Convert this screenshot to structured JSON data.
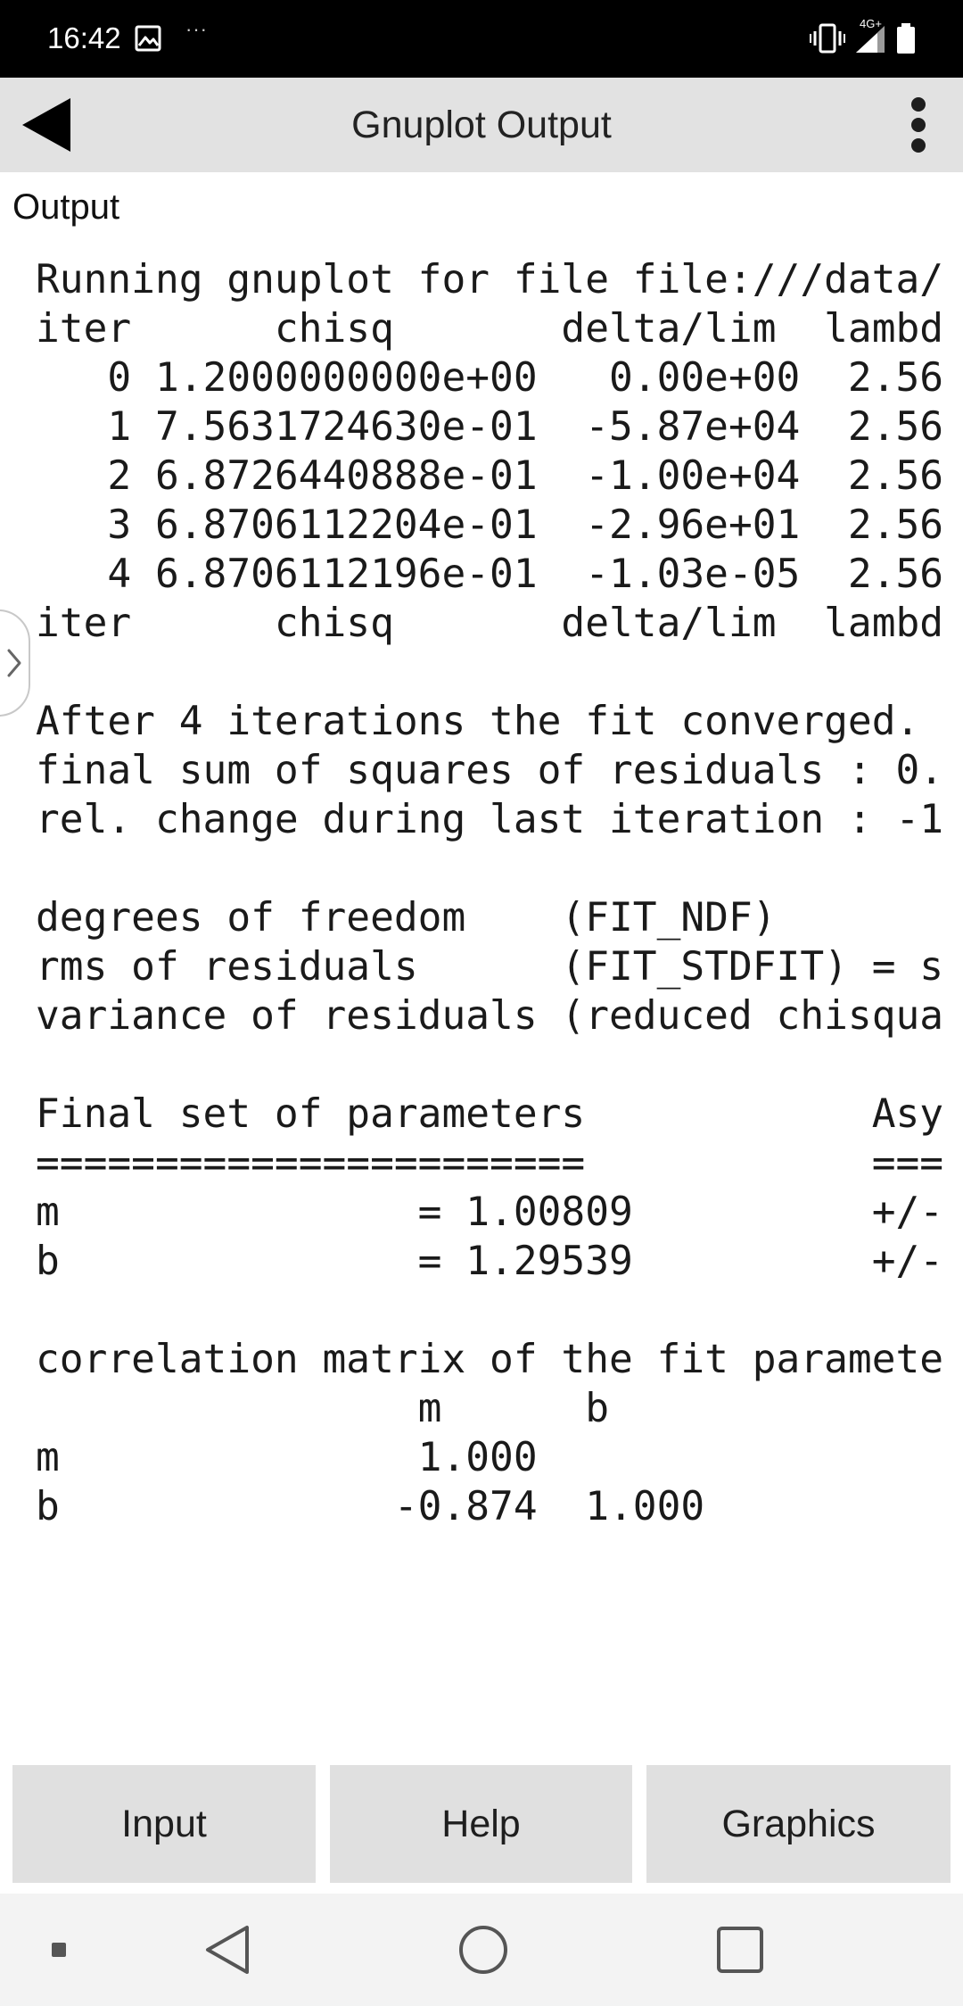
{
  "status_bar": {
    "time": "16:42",
    "more_indicator": "···",
    "network_label": "4G+",
    "icons": [
      "image-notification-icon",
      "vibrate-icon",
      "signal-icon",
      "battery-icon"
    ]
  },
  "app_bar": {
    "title": "Gnuplot Output",
    "back_icon": "back-arrow-icon",
    "overflow_icon": "overflow-menu-icon"
  },
  "output": {
    "label": "Output",
    "lines": [
      "Running gnuplot for file file:///data/",
      "iter      chisq       delta/lim  lambd",
      "   0 1.2000000000e+00   0.00e+00  2.56",
      "   1 7.5631724630e-01  -5.87e+04  2.56",
      "   2 6.8726440888e-01  -1.00e+04  2.56",
      "   3 6.8706112204e-01  -2.96e+01  2.56",
      "   4 6.8706112196e-01  -1.03e-05  2.56",
      "iter      chisq       delta/lim  lambd",
      "",
      "After 4 iterations the fit converged.",
      "final sum of squares of residuals : 0.",
      "rel. change during last iteration : -1",
      "",
      "degrees of freedom    (FIT_NDF)",
      "rms of residuals      (FIT_STDFIT) = s",
      "variance of residuals (reduced chisqua",
      "",
      "Final set of parameters            Asy",
      "=======================            ===",
      "m               = 1.00809          +/-",
      "b               = 1.29539          +/-",
      "",
      "correlation matrix of the fit paramete",
      "                m      b",
      "m               1.000",
      "b              -0.874  1.000"
    ]
  },
  "drawer": {
    "icon": "chevron-right-icon"
  },
  "buttons": {
    "input": "Input",
    "help": "Help",
    "graphics": "Graphics"
  },
  "nav_bar": {
    "icons": [
      "recent-dot-icon",
      "back-triangle-icon",
      "home-circle-icon",
      "overview-square-icon"
    ]
  },
  "colors": {
    "status_bar": "#000000",
    "app_bar": "#e2e2e2",
    "button": "#e0e0e0",
    "nav_bar": "#f3f3f3",
    "text": "#1a1a1a"
  }
}
